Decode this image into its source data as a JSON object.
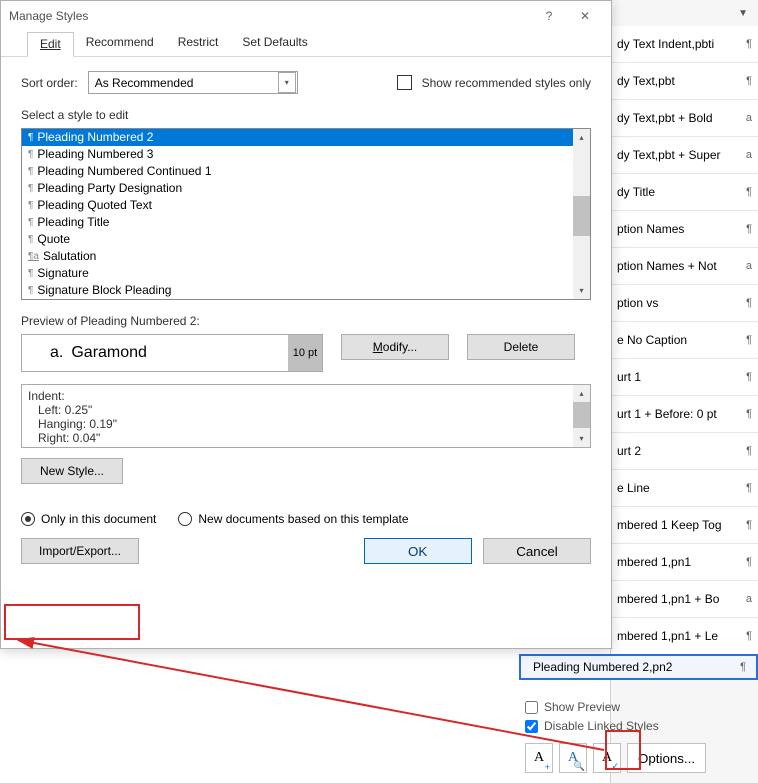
{
  "styles_panel": {
    "items": [
      {
        "name": "dy Text Indent,pbti",
        "badge": "¶"
      },
      {
        "name": "dy Text,pbt",
        "badge": "¶"
      },
      {
        "name": "dy Text,pbt + Bold",
        "badge": "a"
      },
      {
        "name": "dy Text,pbt + Super",
        "badge": "a"
      },
      {
        "name": "dy Title",
        "badge": "¶"
      },
      {
        "name": "ption Names",
        "badge": "¶"
      },
      {
        "name": "ption Names + Not",
        "badge": "a"
      },
      {
        "name": "ption vs",
        "badge": "¶"
      },
      {
        "name": "e No Caption",
        "badge": "¶"
      },
      {
        "name": "urt 1",
        "badge": "¶"
      },
      {
        "name": "urt 1 + Before:  0 pt",
        "badge": "¶"
      },
      {
        "name": "urt 2",
        "badge": "¶"
      },
      {
        "name": "e Line",
        "badge": "¶"
      },
      {
        "name": "mbered 1 Keep Tog",
        "badge": "¶"
      },
      {
        "name": "mbered 1,pn1",
        "badge": "¶"
      },
      {
        "name": "mbered 1,pn1 + Bo",
        "badge": "a"
      },
      {
        "name": "mbered 1,pn1 + Le",
        "badge": "¶"
      }
    ],
    "selected": {
      "name": "Pleading Numbered 2,pn2",
      "badge": "¶"
    },
    "show_preview": "Show Preview",
    "disable_linked": "Disable Linked Styles",
    "options_btn": "Options..."
  },
  "dialog": {
    "title": "Manage Styles",
    "tabs": {
      "edit": "Edit",
      "recommend": "Recommend",
      "restrict": "Restrict",
      "defaults": "Set Defaults"
    },
    "sort_label": "Sort order:",
    "sort_value": "As Recommended",
    "show_recommended": "Show recommended styles only",
    "select_label": "Select a style to edit",
    "styles": [
      "Pleading Numbered 2",
      "Pleading Numbered 3",
      "Pleading Numbered Continued 1",
      "Pleading Party Designation",
      "Pleading Quoted Text",
      "Pleading Title",
      "Quote",
      "Salutation",
      "Signature",
      "Signature Block Pleading"
    ],
    "preview_label": "Preview of Pleading Numbered 2:",
    "preview_sample_letter": "a.",
    "preview_sample_font": "Garamond",
    "preview_pt": "10 pt",
    "modify_btn": "Modify...",
    "delete_btn": "Delete",
    "detail_lines": [
      "Indent:",
      "Left:  0.25\"",
      "Hanging:  0.19\"",
      "Right:  0.04\""
    ],
    "new_style_btn": "New Style...",
    "only_doc": "Only in this document",
    "on_template": "New documents based on this template",
    "import_export": "Import/Export...",
    "ok": "OK",
    "cancel": "Cancel"
  }
}
